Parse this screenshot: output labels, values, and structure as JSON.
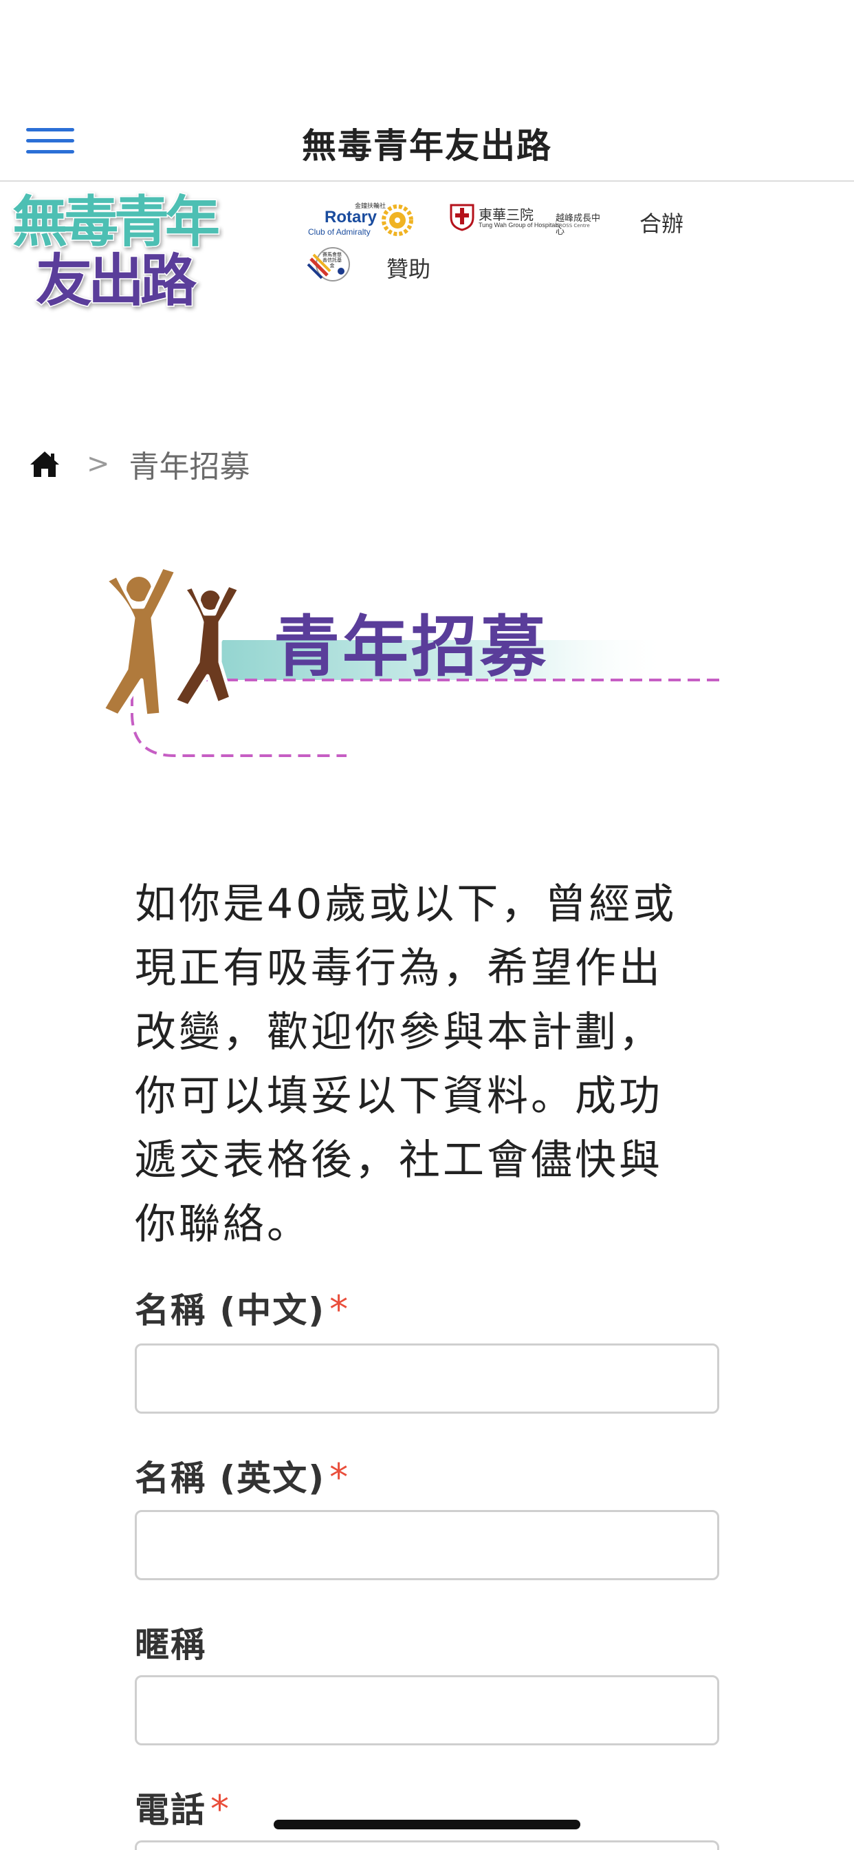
{
  "header": {
    "title": "無毒青年友出路",
    "menu_icon": "hamburger-menu-icon"
  },
  "brand": {
    "logo_line1": "無毒青年",
    "logo_line2": "友出路",
    "colors": {
      "teal": "#4dbfb3",
      "purple": "#5a3d9a"
    }
  },
  "partners": {
    "rotary_name": "Rotary",
    "rotary_sub": "Club of Admiralty",
    "rotary_cn": "金鐘扶輪社",
    "tungwah_cn": "東華三院",
    "tungwah_en": "Tung Wah Group of Hospitals",
    "tungwah_center": "越峰成長中心",
    "tungwah_center_en": "CROSS Centre",
    "co_organizer_label": "合辦",
    "sponsor_badge_text": "賽馬會慈善信託基金",
    "sponsor_label": "贊助"
  },
  "breadcrumb": {
    "home_icon": "home-icon",
    "separator": ">",
    "current": "青年招募"
  },
  "section": {
    "title": "青年招募",
    "icon": "people-cheering-icon"
  },
  "intro": {
    "lines": [
      "如你是40歲或以下，曾經或",
      "現正有吸毒行為，希望作出",
      "改變，歡迎你參與本計劃，",
      "你可以填妥以下資料。成功",
      "遞交表格後，社工會儘快與",
      "你聯絡。"
    ]
  },
  "form": {
    "name_cn_label": "名稱 (中文)",
    "name_en_label": "名稱 (英文)",
    "nickname_label": "暱稱",
    "phone_label": "電話",
    "required_mark": "*",
    "name_cn_value": "",
    "name_en_value": "",
    "nickname_value": ""
  }
}
